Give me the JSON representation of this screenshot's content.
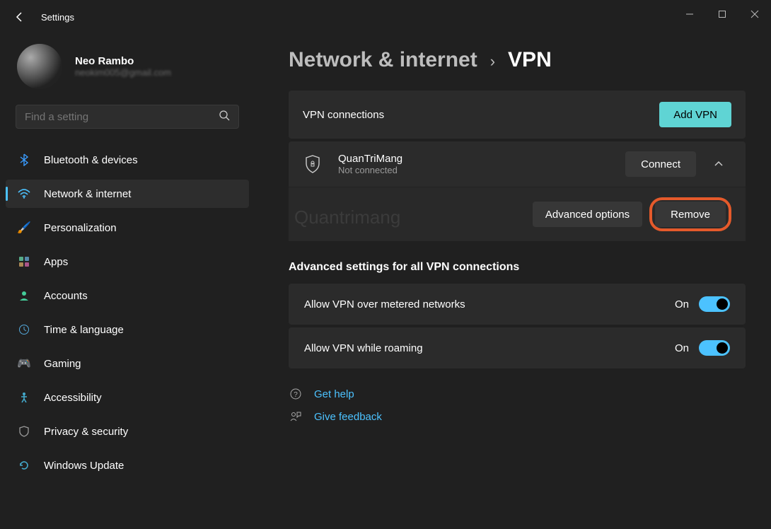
{
  "window": {
    "title": "Settings"
  },
  "user": {
    "name": "Neo Rambo",
    "email": "neokim005@gmail.com"
  },
  "search": {
    "placeholder": "Find a setting"
  },
  "sidebar": {
    "items": [
      {
        "label": "Bluetooth & devices",
        "icon": "bluetooth"
      },
      {
        "label": "Network & internet",
        "icon": "wifi",
        "active": true
      },
      {
        "label": "Personalization",
        "icon": "brush"
      },
      {
        "label": "Apps",
        "icon": "apps"
      },
      {
        "label": "Accounts",
        "icon": "person"
      },
      {
        "label": "Time & language",
        "icon": "globe-clock"
      },
      {
        "label": "Gaming",
        "icon": "gamepad"
      },
      {
        "label": "Accessibility",
        "icon": "accessibility"
      },
      {
        "label": "Privacy & security",
        "icon": "shield"
      },
      {
        "label": "Windows Update",
        "icon": "update"
      }
    ]
  },
  "breadcrumb": {
    "parent": "Network & internet",
    "current": "VPN"
  },
  "vpn": {
    "connections_label": "VPN connections",
    "add_button": "Add VPN",
    "connection": {
      "name": "QuanTriMang",
      "status": "Not connected"
    },
    "connect_button": "Connect",
    "advanced_button": "Advanced options",
    "remove_button": "Remove"
  },
  "advanced_section": {
    "title": "Advanced settings for all VPN connections",
    "toggles": [
      {
        "label": "Allow VPN over metered networks",
        "state": "On"
      },
      {
        "label": "Allow VPN while roaming",
        "state": "On"
      }
    ]
  },
  "help": {
    "get_help": "Get help",
    "feedback": "Give feedback"
  },
  "watermark": "Quantrimang"
}
